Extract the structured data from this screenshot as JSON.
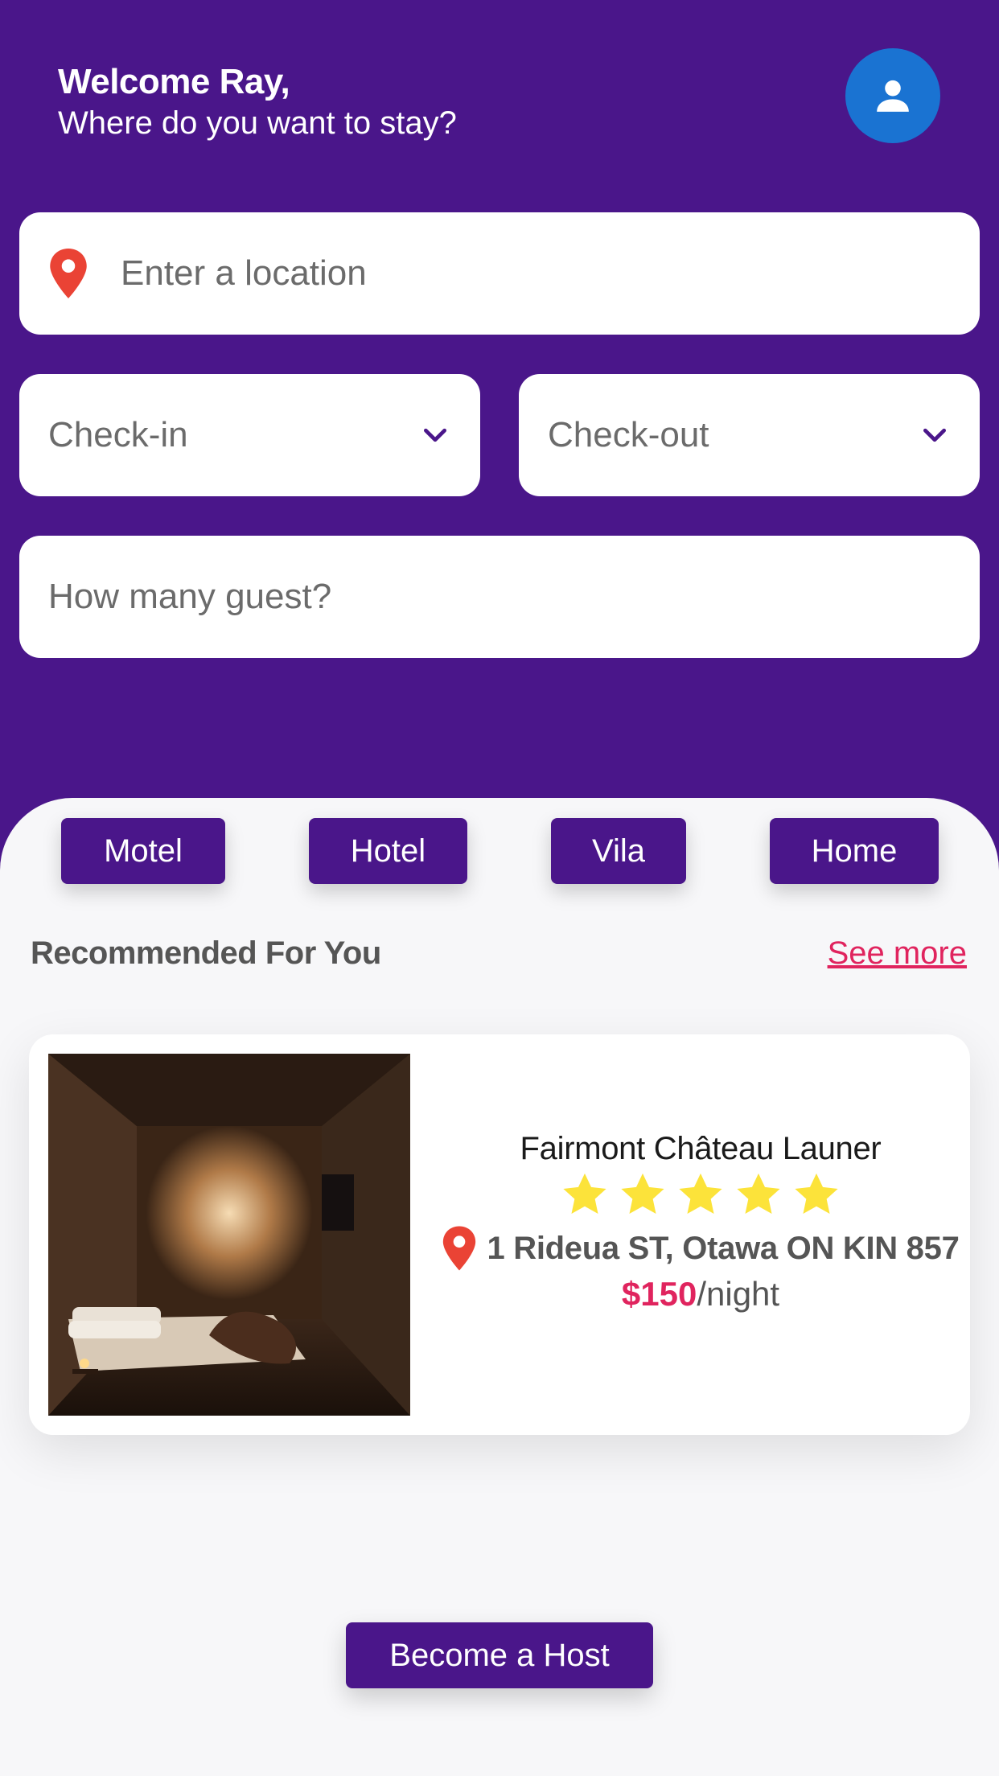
{
  "header": {
    "welcome": "Welcome Ray,",
    "subtitle": "Where do you want to stay?"
  },
  "search": {
    "location_placeholder": "Enter a location",
    "checkin_placeholder": "Check-in",
    "checkout_placeholder": "Check-out",
    "guests_placeholder": "How many guest?"
  },
  "categories": [
    "Motel",
    "Hotel",
    "Vila",
    "Home"
  ],
  "recommended": {
    "title": "Recommended For You",
    "see_more": "See more"
  },
  "listing": {
    "name": "Fairmont Château Launer",
    "rating": 5,
    "address": "1 Rideua ST, Otawa ON KIN 857",
    "price": "$150",
    "price_unit": "/night"
  },
  "become_host": "Become a Host",
  "colors": {
    "primary": "#4a168a",
    "accent": "#e0245e",
    "star": "#fce33a",
    "pin": "#ea4335",
    "avatar_bg": "#1a73d2"
  },
  "icons": {
    "avatar": "user-icon",
    "location": "map-pin-icon",
    "dropdown": "chevron-down-icon",
    "rating": "star-icon"
  }
}
